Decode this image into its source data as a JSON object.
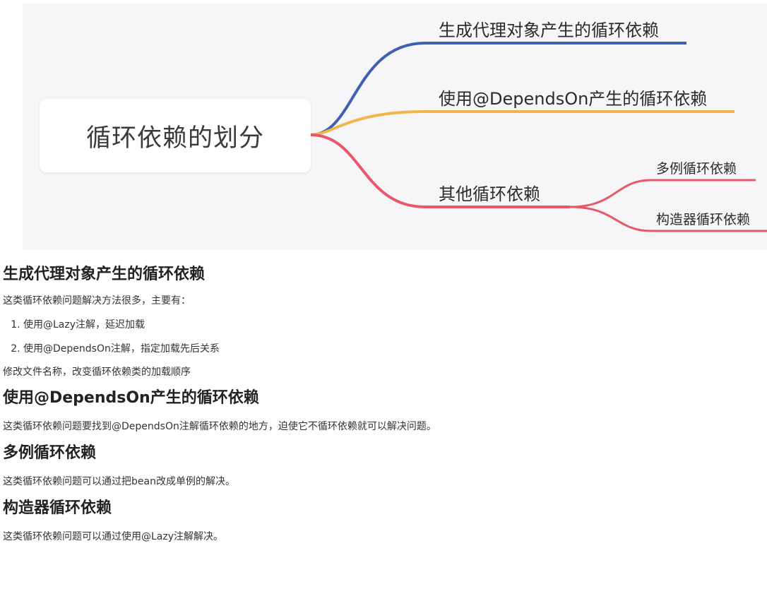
{
  "mindmap": {
    "root": "循环依赖的划分",
    "branches": [
      {
        "label": "生成代理对象产生的循环依赖",
        "color": "#3f5fb0"
      },
      {
        "label": "使用@DependsOn产生的循环依赖",
        "color": "#f0b64a"
      },
      {
        "label": "其他循环依赖",
        "color": "#e8586a"
      }
    ],
    "leaves": [
      "多例循环依赖",
      "构造器循环依赖"
    ],
    "background": "#f6f6f8"
  },
  "sections": [
    {
      "heading": "生成代理对象产生的循环依赖",
      "intro": "这类循环依赖问题解决方法很多，主要有：",
      "list": [
        "使用@Lazy注解，延迟加载",
        "使用@DependsOn注解，指定加载先后关系"
      ],
      "outro": "修改文件名称，改变循环依赖类的加载顺序"
    },
    {
      "heading": "使用@DependsOn产生的循环依赖",
      "body": "这类循环依赖问题要找到@DependsOn注解循环依赖的地方，迫使它不循环依赖就可以解决问题。"
    },
    {
      "heading": "多例循环依赖",
      "body": "这类循环依赖问题可以通过把bean改成单例的解决。"
    },
    {
      "heading": "构造器循环依赖",
      "body": "这类循环依赖问题可以通过使用@Lazy注解解决。"
    }
  ]
}
